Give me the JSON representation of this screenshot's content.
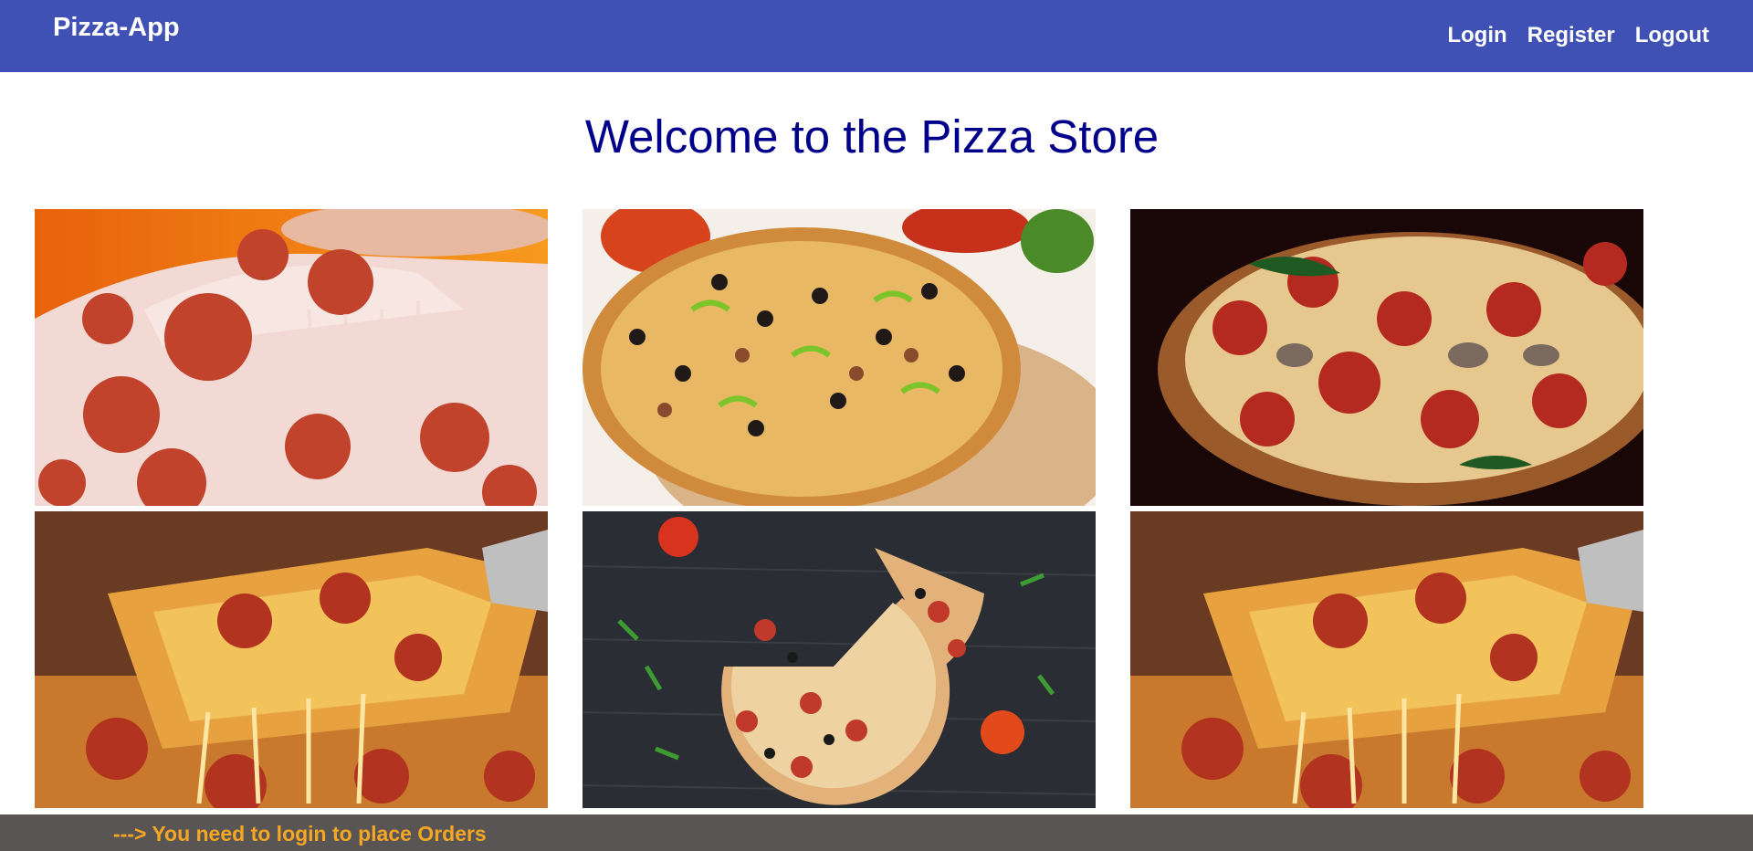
{
  "navbar": {
    "brand": "Pizza-App",
    "links": [
      {
        "label": "Login"
      },
      {
        "label": "Register"
      },
      {
        "label": "Logout"
      }
    ]
  },
  "main": {
    "title": "Welcome to the Pizza Store"
  },
  "gallery": {
    "images": [
      {
        "name": "pepperoni-slice-orange"
      },
      {
        "name": "supreme-pizza-sliced"
      },
      {
        "name": "pepperoni-mushroom-pizza-dark"
      },
      {
        "name": "cheesy-pizza-slice-lift"
      },
      {
        "name": "pizza-on-dark-wood"
      },
      {
        "name": "cheesy-pizza-slice-lift"
      }
    ]
  },
  "footer": {
    "message": "---> You need to login to place Orders"
  },
  "colors": {
    "navbar": "#3f51b5",
    "title": "#00008b",
    "footer_bg": "#5a5555",
    "footer_text": "#f5a623"
  }
}
